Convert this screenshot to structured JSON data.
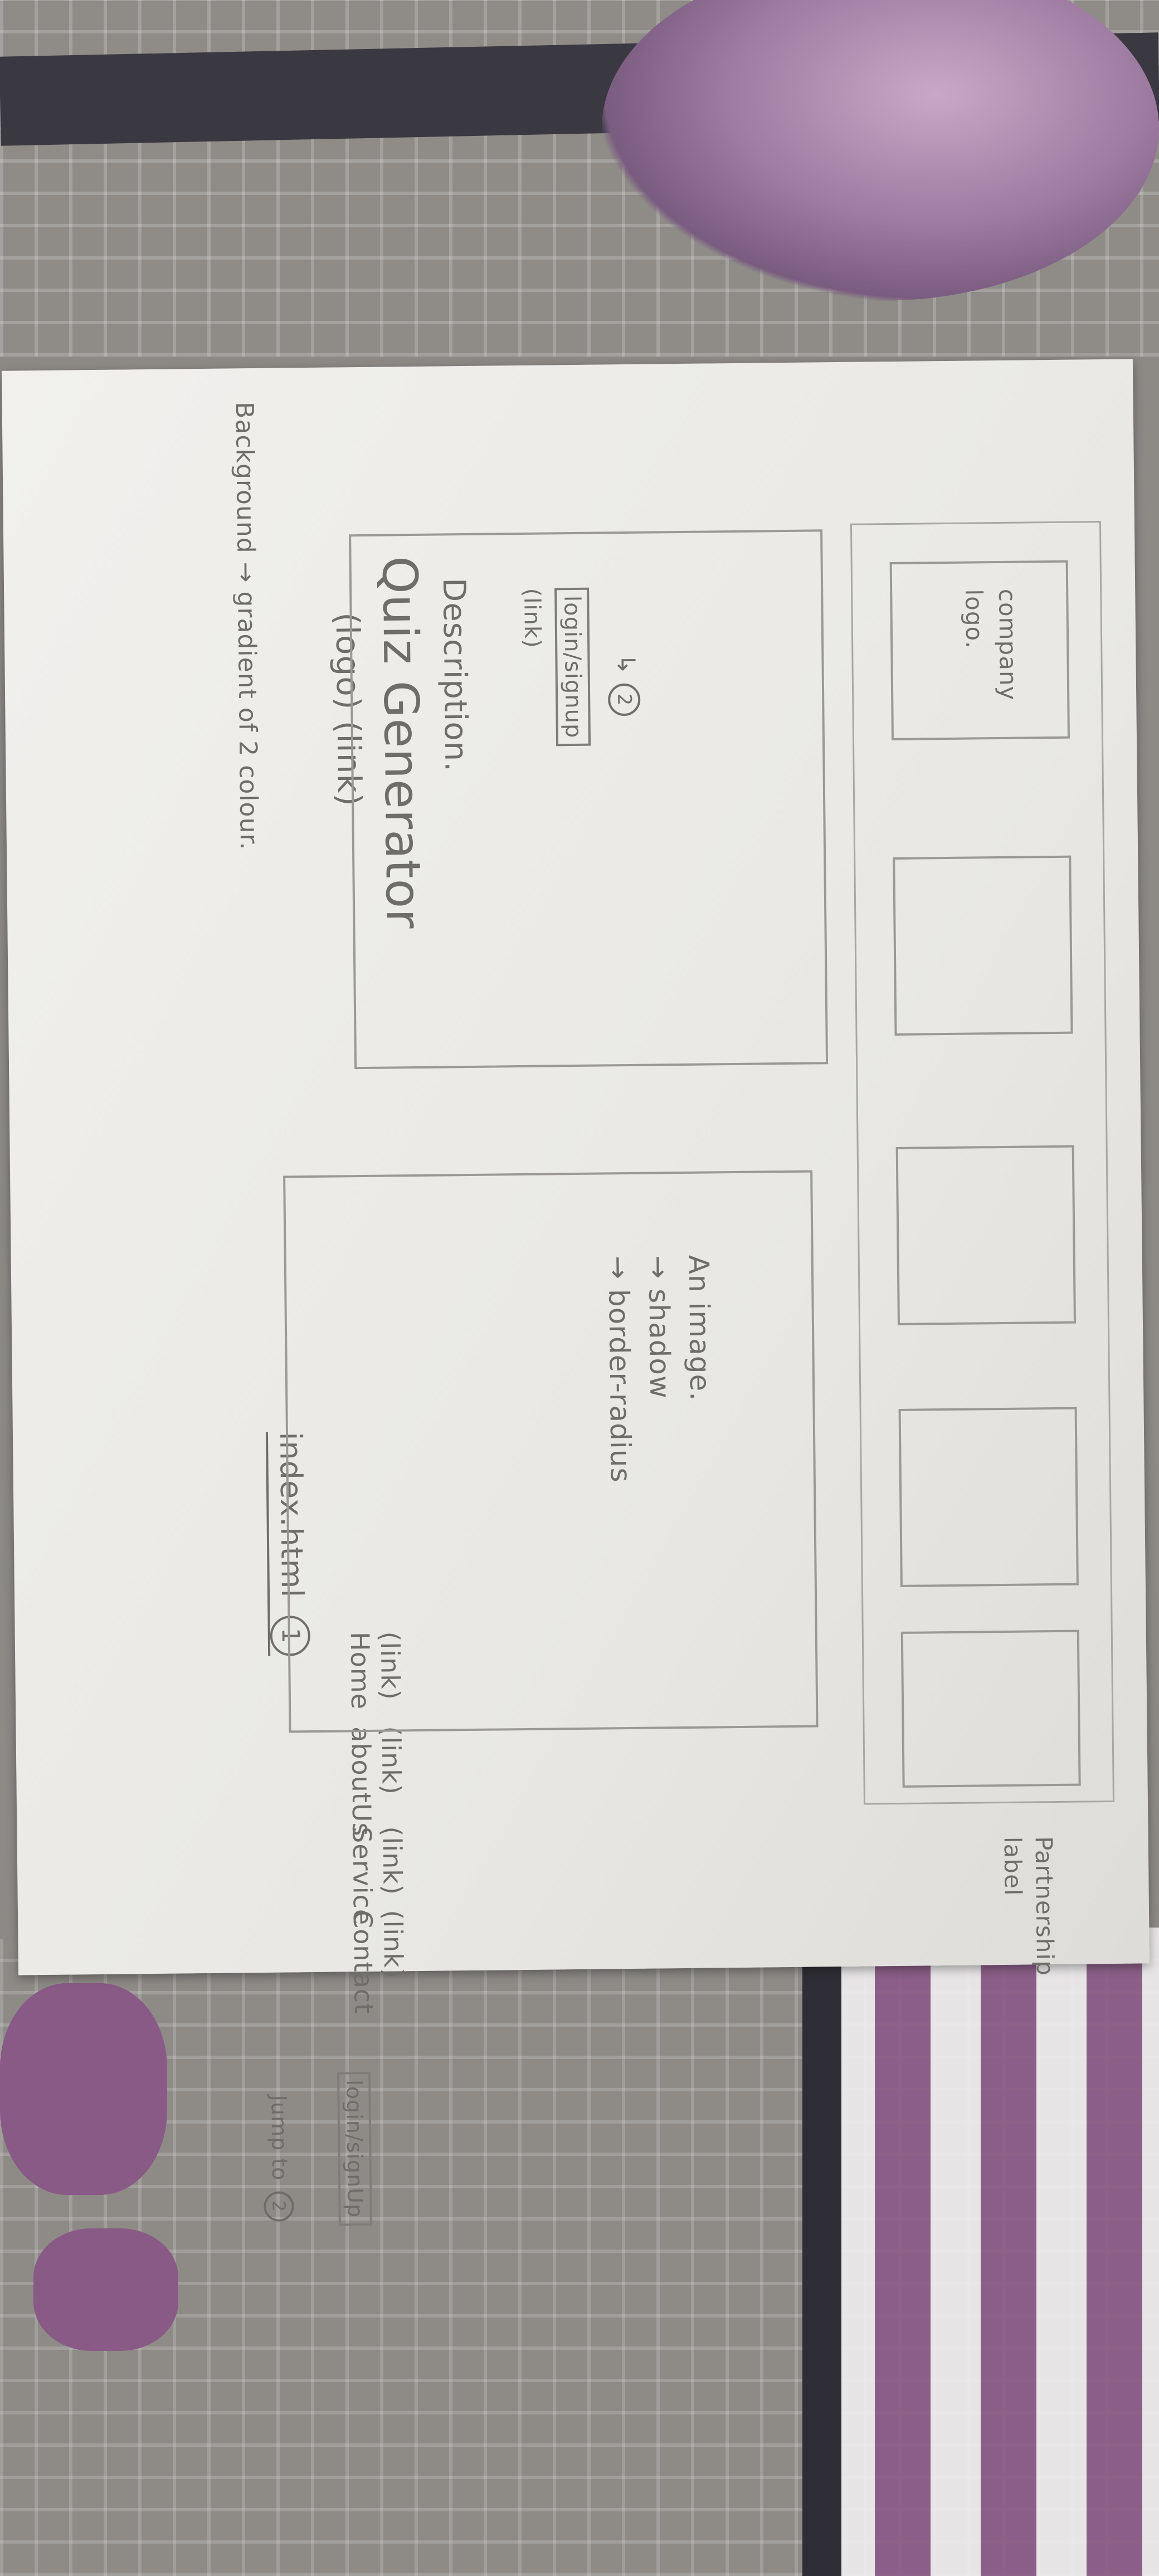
{
  "sketch": {
    "page_name": "index.html",
    "page_number": "1",
    "background_note": "Background → gradient of 2 colour.",
    "header": {
      "logo_link": "(logo) (link)",
      "title": "Quiz Generator",
      "nav": [
        {
          "tag": "(link)",
          "label": "Home"
        },
        {
          "tag": "(link)",
          "label": "aboutUs"
        },
        {
          "tag": "(link)",
          "label": "Service"
        },
        {
          "tag": "(link)",
          "label": "Contact"
        }
      ],
      "jump_note": "Jump to",
      "jump_target": "2",
      "login_button": "login/signUp"
    },
    "hero_left": {
      "description": "Description.",
      "login_signup": "login/signup",
      "link_tag": "(link)",
      "arrow_target": "2"
    },
    "hero_right": {
      "line1": "An image.",
      "line2": "→ shadow",
      "line3": "→ border-radius"
    },
    "partners": {
      "first_box_line1": "company",
      "first_box_line2": "logo.",
      "side_label_line1": "Partnership",
      "side_label_line2": "label"
    }
  }
}
